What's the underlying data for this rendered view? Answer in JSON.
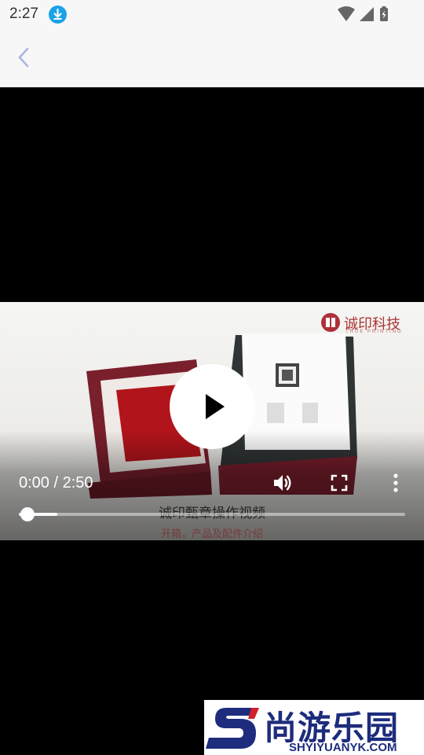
{
  "status_bar": {
    "time": "2:27",
    "icons": [
      "download-icon",
      "wifi-icon",
      "signal-icon",
      "battery-charging-icon"
    ]
  },
  "app_bar": {
    "back_icon": "back-arrow-icon"
  },
  "video": {
    "brand": {
      "name": "诚印科技",
      "tagline": "TRUE PRINTING"
    },
    "timecode": "0:00 / 2:50",
    "progress": 0.0,
    "buffered": 0.1,
    "caption_line1": "诚印甄章操作视频",
    "caption_line2": "开箱，产品及配件介绍",
    "controls": [
      "play-icon",
      "volume-icon",
      "fullscreen-icon",
      "more-icon"
    ]
  },
  "watermark": {
    "title": "尚游乐园",
    "url": "SHYIYUANYK.COM"
  },
  "colors": {
    "accent": "#1aa3e8",
    "brand_red": "#a33333",
    "watermark_blue": "#1d2c7c"
  }
}
